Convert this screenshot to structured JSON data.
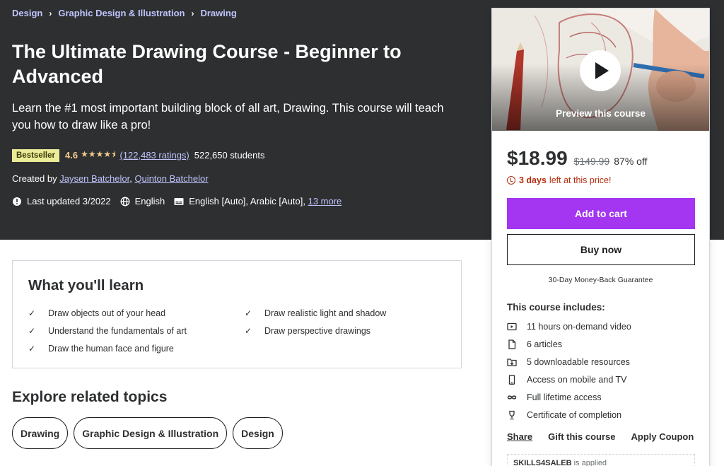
{
  "breadcrumb": [
    {
      "label": "Design"
    },
    {
      "label": "Graphic Design & Illustration"
    },
    {
      "label": "Drawing"
    }
  ],
  "course": {
    "title": "The Ultimate Drawing Course - Beginner to Advanced",
    "subtitle": "Learn the #1 most important building block of all art, Drawing. This course will teach you how to draw like a pro!",
    "badge": "Bestseller",
    "rating": "4.6",
    "ratings_count": "(122,483 ratings)",
    "students": "522,650 students",
    "created_by_label": "Created by",
    "instructors": [
      "Jaysen Batchelor",
      "Quinton Batchelor"
    ],
    "last_updated": "Last updated 3/2022",
    "language": "English",
    "captions": "English [Auto], Arabic [Auto],",
    "more_captions": "13 more"
  },
  "learn": {
    "title": "What you'll learn",
    "items": [
      "Draw objects out of your head",
      "Draw realistic light and shadow",
      "Understand the fundamentals of art",
      "Draw perspective drawings",
      "Draw the human face and figure"
    ]
  },
  "explore": {
    "title": "Explore related topics",
    "topics": [
      "Drawing",
      "Graphic Design & Illustration",
      "Design"
    ]
  },
  "sidebar": {
    "preview_label": "Preview this course",
    "price": "$18.99",
    "original_price": "$149.99",
    "discount": "87% off",
    "timer_bold": "3 days",
    "timer_text": "left at this price!",
    "add_to_cart": "Add to cart",
    "buy_now": "Buy now",
    "guarantee": "30-Day Money-Back Guarantee",
    "includes_title": "This course includes:",
    "includes": [
      {
        "icon": "video-icon",
        "label": "11 hours on-demand video"
      },
      {
        "icon": "article-icon",
        "label": "6 articles"
      },
      {
        "icon": "download-icon",
        "label": "5 downloadable resources"
      },
      {
        "icon": "mobile-icon",
        "label": "Access on mobile and TV"
      },
      {
        "icon": "infinity-icon",
        "label": "Full lifetime access"
      },
      {
        "icon": "trophy-icon",
        "label": "Certificate of completion"
      }
    ],
    "share": "Share",
    "gift": "Gift this course",
    "coupon_action": "Apply Coupon",
    "coupon_code": "SKILLS4SALEB",
    "coupon_text": "is applied"
  },
  "colors": {
    "hero_bg": "#2d2f31",
    "accent_purple": "#a435f0",
    "link_lavender": "#c0c4fc",
    "star_gold": "#f3ca8c",
    "badge_yellow": "#eceb98",
    "timer_red": "#b32d0f"
  },
  "stars": "★★★★⯨"
}
